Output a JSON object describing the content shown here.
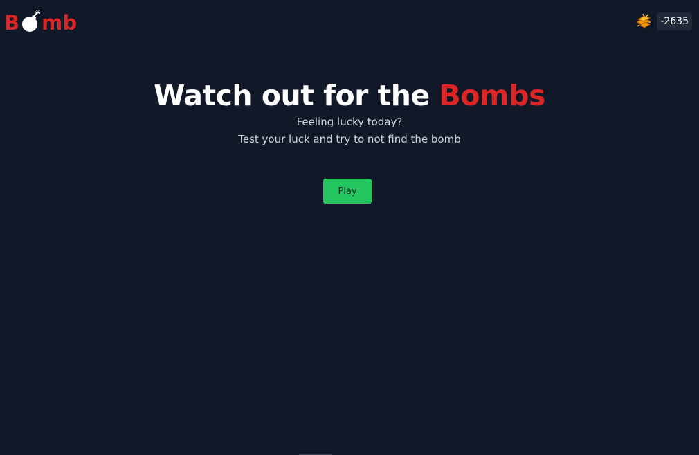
{
  "header": {
    "logo": {
      "prefix": "B",
      "suffix": "mb",
      "icon": "bomb-icon"
    },
    "balance": {
      "icon": "gold-coins-icon",
      "value": "-2635"
    }
  },
  "hero": {
    "title_main": "Watch out for the ",
    "title_accent": "Bombs",
    "subtitle_line1": "Feeling lucky today?",
    "subtitle_line2": "Test your luck and try to not find the bomb"
  },
  "actions": {
    "play_label": "Play"
  },
  "colors": {
    "background": "#111827",
    "accent": "#dc2626",
    "play": "#22c55e",
    "coin": "#f59e0b"
  }
}
